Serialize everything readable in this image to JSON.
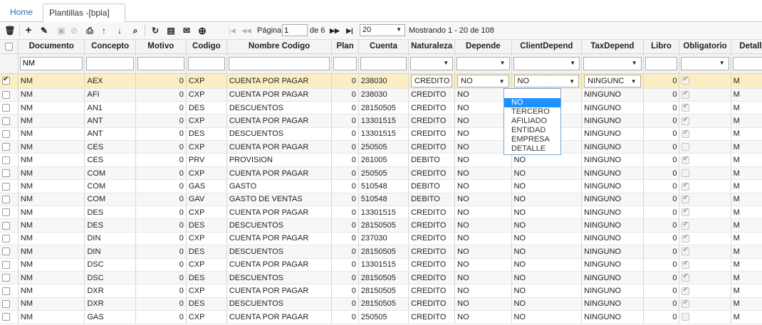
{
  "tabs": {
    "home": "Home",
    "active": "Plantillas -[bpla]",
    "close": "×"
  },
  "toolbar": {
    "icons": [
      "trash-icon",
      "plus-icon",
      "pencil-icon",
      "save-icon",
      "cancel-icon",
      "print-icon",
      "upload-icon",
      "download-icon",
      "search-icon",
      "refresh-icon",
      "comment-icon",
      "mail-icon",
      "add-circle-icon"
    ],
    "pagination": {
      "page_label": "Página",
      "page_value": "1",
      "of_label": "de 6",
      "page_size": "20",
      "showing": "Mostrando 1 - 20 de 108"
    }
  },
  "columns": [
    "Documento",
    "Concepto",
    "Motivo",
    "Codigo",
    "Nombre Codigo",
    "Plan",
    "Cuenta",
    "Naturaleza",
    "Depende",
    "ClientDepend",
    "TaxDepend",
    "Libro",
    "Obligatorio",
    "Detalle N"
  ],
  "filter": {
    "documento": "NM"
  },
  "selected_row": {
    "doc": "NM",
    "concepto": "AEX",
    "motivo": "0",
    "codigo": "CXP",
    "nombre": "CUENTA POR PAGAR",
    "plan": "0",
    "cuenta": "238030",
    "naturaleza": "CREDITO",
    "depende": "NO",
    "client": "NO",
    "tax": "NINGUNC",
    "libro": "0",
    "detalle": "M"
  },
  "dropdown_options": [
    "NO",
    "TERCERO",
    "AFILIADO",
    "ENTIDAD",
    "EMPRESA",
    "DETALLE"
  ],
  "rows": [
    [
      "NM",
      "AFI",
      "0",
      "CXP",
      "CUENTA POR PAGAR",
      "0",
      "238030",
      "CREDITO",
      "NO",
      "",
      "NINGUNO",
      "0",
      true,
      "M"
    ],
    [
      "NM",
      "AN1",
      "0",
      "DES",
      "DESCUENTOS",
      "0",
      "28150505",
      "CREDITO",
      "NO",
      "",
      "NINGUNO",
      "0",
      true,
      "M"
    ],
    [
      "NM",
      "ANT",
      "0",
      "CXP",
      "CUENTA POR PAGAR",
      "0",
      "13301515",
      "CREDITO",
      "NO",
      "",
      "NINGUNO",
      "0",
      true,
      "M"
    ],
    [
      "NM",
      "ANT",
      "0",
      "DES",
      "DESCUENTOS",
      "0",
      "13301515",
      "CREDITO",
      "NO",
      "",
      "NINGUNO",
      "0",
      true,
      "M"
    ],
    [
      "NM",
      "CES",
      "0",
      "CXP",
      "CUENTA POR PAGAR",
      "0",
      "250505",
      "CREDITO",
      "NO",
      "",
      "NINGUNO",
      "0",
      false,
      "M"
    ],
    [
      "NM",
      "CES",
      "0",
      "PRV",
      "PROVISION",
      "0",
      "261005",
      "DEBITO",
      "NO",
      "NO",
      "NINGUNO",
      "0",
      true,
      "M"
    ],
    [
      "NM",
      "COM",
      "0",
      "CXP",
      "CUENTA POR PAGAR",
      "0",
      "250505",
      "CREDITO",
      "NO",
      "NO",
      "NINGUNO",
      "0",
      false,
      "M"
    ],
    [
      "NM",
      "COM",
      "0",
      "GAS",
      "GASTO",
      "0",
      "510548",
      "DEBITO",
      "NO",
      "NO",
      "NINGUNO",
      "0",
      true,
      "M"
    ],
    [
      "NM",
      "COM",
      "0",
      "GAV",
      "GASTO DE VENTAS",
      "0",
      "510548",
      "DEBITO",
      "NO",
      "NO",
      "NINGUNO",
      "0",
      true,
      "M"
    ],
    [
      "NM",
      "DES",
      "0",
      "CXP",
      "CUENTA POR PAGAR",
      "0",
      "13301515",
      "CREDITO",
      "NO",
      "NO",
      "NINGUNO",
      "0",
      true,
      "M"
    ],
    [
      "NM",
      "DES",
      "0",
      "DES",
      "DESCUENTOS",
      "0",
      "28150505",
      "CREDITO",
      "NO",
      "NO",
      "NINGUNO",
      "0",
      true,
      "M"
    ],
    [
      "NM",
      "DIN",
      "0",
      "CXP",
      "CUENTA POR PAGAR",
      "0",
      "237030",
      "CREDITO",
      "NO",
      "NO",
      "NINGUNO",
      "0",
      true,
      "M"
    ],
    [
      "NM",
      "DIN",
      "0",
      "DES",
      "DESCUENTOS",
      "0",
      "28150505",
      "CREDITO",
      "NO",
      "NO",
      "NINGUNO",
      "0",
      true,
      "M"
    ],
    [
      "NM",
      "DSC",
      "0",
      "CXP",
      "CUENTA POR PAGAR",
      "0",
      "13301515",
      "CREDITO",
      "NO",
      "NO",
      "NINGUNO",
      "0",
      true,
      "M"
    ],
    [
      "NM",
      "DSC",
      "0",
      "DES",
      "DESCUENTOS",
      "0",
      "28150505",
      "CREDITO",
      "NO",
      "NO",
      "NINGUNO",
      "0",
      true,
      "M"
    ],
    [
      "NM",
      "DXR",
      "0",
      "CXP",
      "CUENTA POR PAGAR",
      "0",
      "28150505",
      "CREDITO",
      "NO",
      "NO",
      "NINGUNO",
      "0",
      true,
      "M"
    ],
    [
      "NM",
      "DXR",
      "0",
      "DES",
      "DESCUENTOS",
      "0",
      "28150505",
      "CREDITO",
      "NO",
      "NO",
      "NINGUNO",
      "0",
      true,
      "M"
    ],
    [
      "NM",
      "GAS",
      "0",
      "CXP",
      "CUENTA POR PAGAR",
      "0",
      "250505",
      "CREDITO",
      "NO",
      "NO",
      "NINGUNO",
      "0",
      false,
      "M"
    ]
  ]
}
